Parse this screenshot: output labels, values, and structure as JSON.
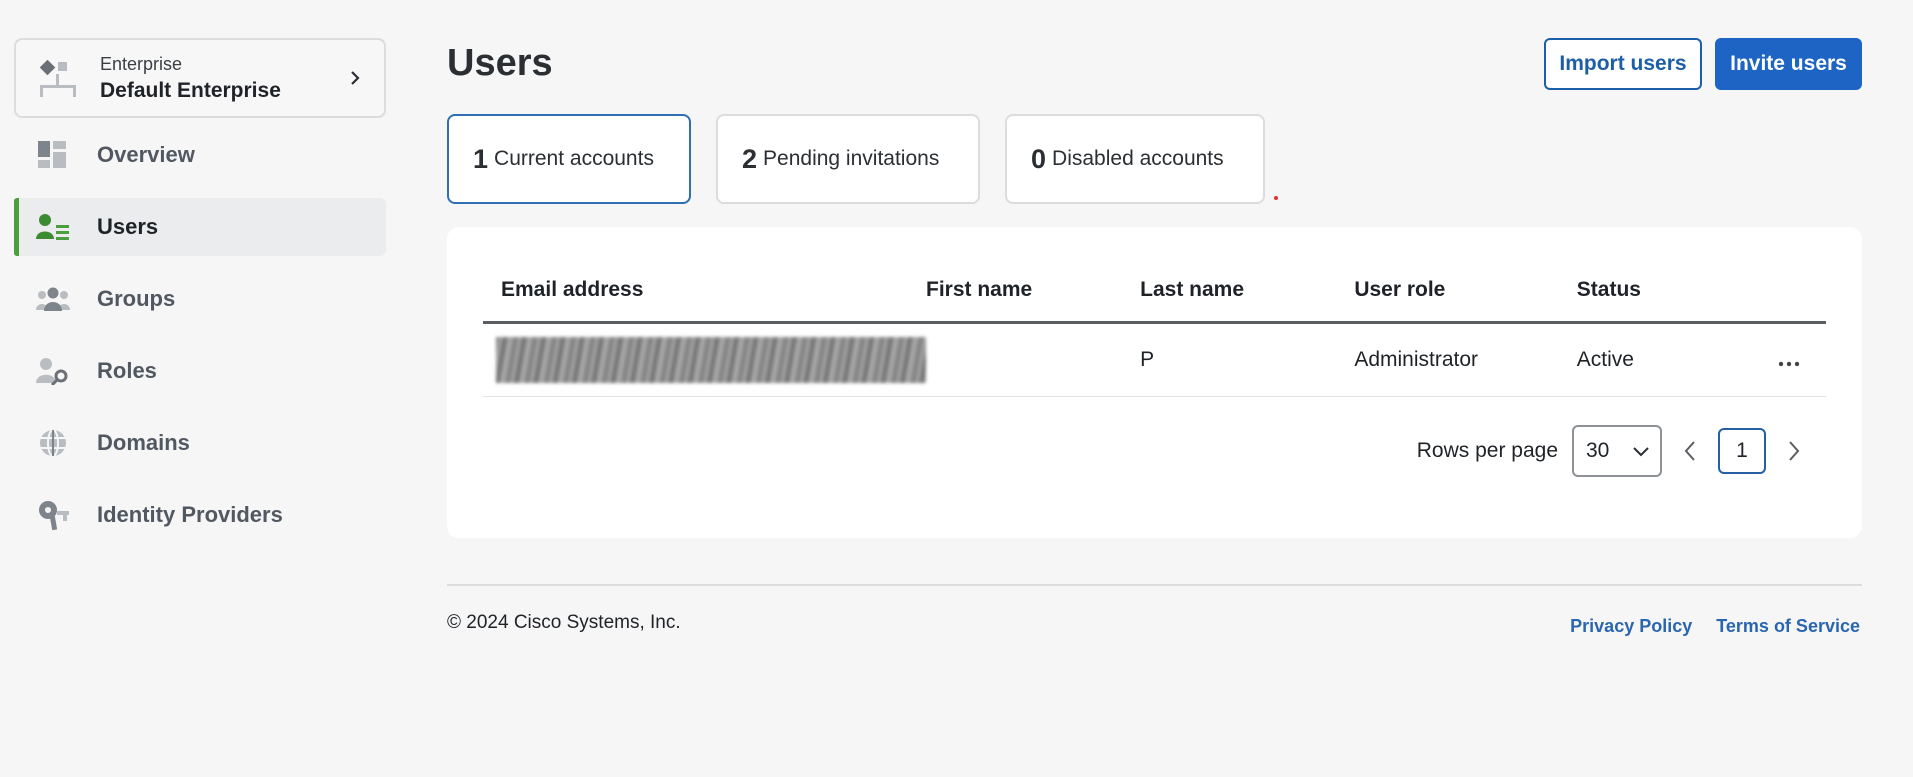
{
  "sidebar": {
    "enterprise": {
      "label": "Enterprise",
      "name": "Default Enterprise"
    },
    "items": [
      {
        "label": "Overview",
        "icon": "dashboard-icon"
      },
      {
        "label": "Users",
        "icon": "users-icon",
        "active": true
      },
      {
        "label": "Groups",
        "icon": "groups-icon"
      },
      {
        "label": "Roles",
        "icon": "roles-icon"
      },
      {
        "label": "Domains",
        "icon": "globe-icon"
      },
      {
        "label": "Identity Providers",
        "icon": "key-icon"
      }
    ]
  },
  "header": {
    "title": "Users",
    "import_label": "Import users",
    "invite_label": "Invite users"
  },
  "tabs": [
    {
      "count": "1",
      "label": "Current accounts",
      "active": true
    },
    {
      "count": "2",
      "label": "Pending invitations"
    },
    {
      "count": "0",
      "label": "Disabled accounts"
    }
  ],
  "table": {
    "columns": [
      "Email address",
      "First name",
      "Last name",
      "User role",
      "Status"
    ],
    "rows": [
      {
        "email": "",
        "first_name": "",
        "last_name": "P",
        "role": "Administrator",
        "status": "Active"
      }
    ]
  },
  "pagination": {
    "rows_per_page_label": "Rows per page",
    "rows_per_page": "30",
    "current_page": "1"
  },
  "footer": {
    "copyright": "© 2024 Cisco Systems, Inc.",
    "privacy": "Privacy Policy",
    "terms": "Terms of Service"
  },
  "colors": {
    "accent": "#1d64c4",
    "active_nav": "#4a9e3c",
    "link": "#2a66b0"
  }
}
